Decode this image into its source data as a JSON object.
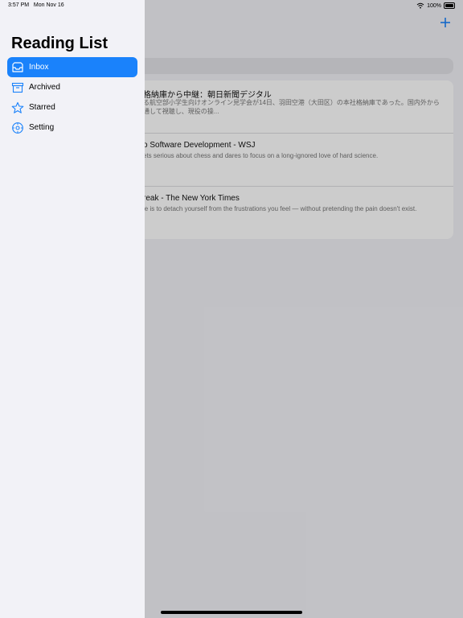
{
  "status_bar": {
    "time": "3:57 PM",
    "date": "Mon Nov 16",
    "battery": "100%",
    "icons": [
      "wifi-icon",
      "battery-icon"
    ]
  },
  "sidebar": {
    "title": "Reading List",
    "items": [
      {
        "label": "Inbox",
        "icon": "inbox-tray-icon",
        "selected": true
      },
      {
        "label": "Archived",
        "icon": "archive-box-icon",
        "selected": false
      },
      {
        "label": "Starred",
        "icon": "star-icon",
        "selected": false
      },
      {
        "label": "Setting",
        "icon": "gear-icon",
        "selected": false
      }
    ]
  },
  "main": {
    "add_button_icon": "plus-icon",
    "articles": [
      {
        "title": "格納庫から中継：朝日新聞デジタル",
        "excerpt": "る航空部小学生向けオンライン見学会が14日、羽田空港（大田区）の本社格納庫であった。国内外から 通して視聴し、現役の操..."
      },
      {
        "title": "o Software Development - WSJ",
        "excerpt": "ets serious about chess and dares to focus on a long-ignored love of hard science."
      },
      {
        "title": "reak - The New York Times",
        "excerpt": "le is to detach yourself from the frustrations you feel — without pretending the pain doesn't exist."
      }
    ]
  },
  "colors": {
    "accent": "#1a82fb",
    "sidebar_bg": "#f2f2f7"
  }
}
